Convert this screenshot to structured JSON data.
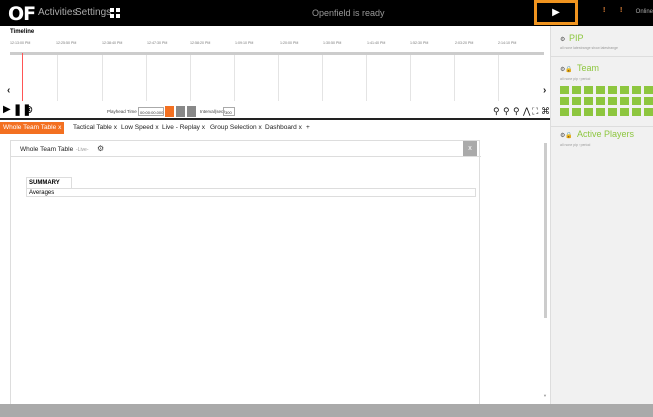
{
  "topbar": {
    "logo": "OF",
    "nav": [
      "Activities",
      "Settings"
    ],
    "status": "Openfield is ready",
    "play_symbol": "▶",
    "alert_marks": [
      "!",
      "!"
    ],
    "online": "Online"
  },
  "timeline": {
    "title": "Timeline",
    "ticks": [
      "12:13:00 PM",
      "12:25:50 PM",
      "12:38:40 PM",
      "12:47:30 PM",
      "12:58:20 PM",
      "1:09:10 PM",
      "1:20:00 PM",
      "1:30:50 PM",
      "1:41:40 PM",
      "1:52:30 PM",
      "2:03:20 PM",
      "2:14:10 PM"
    ],
    "left_arrow": "‹",
    "right_arrow": "›",
    "playhead_label": "Playhead Time",
    "playhead_value": "00:00:00.000",
    "interval_label": "Interval(sec)",
    "interval_value": "300"
  },
  "tabs": [
    {
      "label": "Whole Team Table",
      "close": "x"
    },
    {
      "label": "Tactical Table",
      "close": "x"
    },
    {
      "label": "Low Speed",
      "close": "x"
    },
    {
      "label": "Live - Replay",
      "close": "x"
    },
    {
      "label": "Group Selection",
      "close": "x"
    },
    {
      "label": "Dashboard",
      "close": "x"
    }
  ],
  "add_tab": "+",
  "panel": {
    "title": "Whole Team Table",
    "live": "-Live-",
    "close": "x",
    "summary_tab": "SUMMARY",
    "row_label": "Averages"
  },
  "sidebar": {
    "pip": {
      "title": "PIP",
      "links": "all   none   latestrange   show latestrange"
    },
    "team": {
      "title": "Team",
      "links": "all   none   pip   ↑period"
    },
    "active_players": {
      "title": "Active Players",
      "links": "all   none   pip   ↑period"
    }
  },
  "colors": {
    "accent": "#f37021",
    "highlight": "#f0941f",
    "green": "#8dc63f"
  },
  "icons": {
    "settings": "gear-icon",
    "grid": "grid-icon",
    "lock": "lock-icon"
  }
}
